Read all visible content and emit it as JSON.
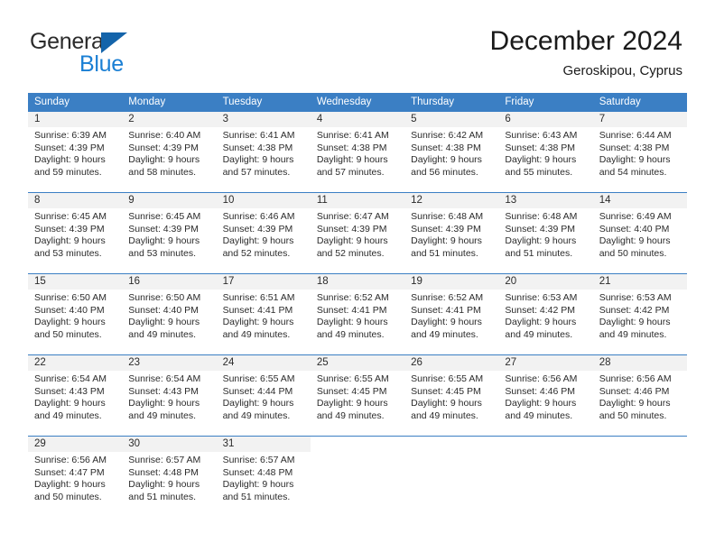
{
  "brand": {
    "word1": "General",
    "word2": "Blue",
    "triangle_color": "#1464aa",
    "blue_color": "#1a7fd4"
  },
  "header": {
    "title": "December 2024",
    "subtitle": "Geroskipou, Cyprus"
  },
  "theme": {
    "header_row_bg": "#3b7fc4",
    "day_number_bg": "#f2f2f2",
    "text_color": "#2b2b2b"
  },
  "calendar": {
    "day_headers": [
      "Sunday",
      "Monday",
      "Tuesday",
      "Wednesday",
      "Thursday",
      "Friday",
      "Saturday"
    ],
    "weeks": [
      [
        {
          "day": "1",
          "sunrise": "Sunrise: 6:39 AM",
          "sunset": "Sunset: 4:39 PM",
          "daylight1": "Daylight: 9 hours",
          "daylight2": "and 59 minutes."
        },
        {
          "day": "2",
          "sunrise": "Sunrise: 6:40 AM",
          "sunset": "Sunset: 4:39 PM",
          "daylight1": "Daylight: 9 hours",
          "daylight2": "and 58 minutes."
        },
        {
          "day": "3",
          "sunrise": "Sunrise: 6:41 AM",
          "sunset": "Sunset: 4:38 PM",
          "daylight1": "Daylight: 9 hours",
          "daylight2": "and 57 minutes."
        },
        {
          "day": "4",
          "sunrise": "Sunrise: 6:41 AM",
          "sunset": "Sunset: 4:38 PM",
          "daylight1": "Daylight: 9 hours",
          "daylight2": "and 57 minutes."
        },
        {
          "day": "5",
          "sunrise": "Sunrise: 6:42 AM",
          "sunset": "Sunset: 4:38 PM",
          "daylight1": "Daylight: 9 hours",
          "daylight2": "and 56 minutes."
        },
        {
          "day": "6",
          "sunrise": "Sunrise: 6:43 AM",
          "sunset": "Sunset: 4:38 PM",
          "daylight1": "Daylight: 9 hours",
          "daylight2": "and 55 minutes."
        },
        {
          "day": "7",
          "sunrise": "Sunrise: 6:44 AM",
          "sunset": "Sunset: 4:38 PM",
          "daylight1": "Daylight: 9 hours",
          "daylight2": "and 54 minutes."
        }
      ],
      [
        {
          "day": "8",
          "sunrise": "Sunrise: 6:45 AM",
          "sunset": "Sunset: 4:39 PM",
          "daylight1": "Daylight: 9 hours",
          "daylight2": "and 53 minutes."
        },
        {
          "day": "9",
          "sunrise": "Sunrise: 6:45 AM",
          "sunset": "Sunset: 4:39 PM",
          "daylight1": "Daylight: 9 hours",
          "daylight2": "and 53 minutes."
        },
        {
          "day": "10",
          "sunrise": "Sunrise: 6:46 AM",
          "sunset": "Sunset: 4:39 PM",
          "daylight1": "Daylight: 9 hours",
          "daylight2": "and 52 minutes."
        },
        {
          "day": "11",
          "sunrise": "Sunrise: 6:47 AM",
          "sunset": "Sunset: 4:39 PM",
          "daylight1": "Daylight: 9 hours",
          "daylight2": "and 52 minutes."
        },
        {
          "day": "12",
          "sunrise": "Sunrise: 6:48 AM",
          "sunset": "Sunset: 4:39 PM",
          "daylight1": "Daylight: 9 hours",
          "daylight2": "and 51 minutes."
        },
        {
          "day": "13",
          "sunrise": "Sunrise: 6:48 AM",
          "sunset": "Sunset: 4:39 PM",
          "daylight1": "Daylight: 9 hours",
          "daylight2": "and 51 minutes."
        },
        {
          "day": "14",
          "sunrise": "Sunrise: 6:49 AM",
          "sunset": "Sunset: 4:40 PM",
          "daylight1": "Daylight: 9 hours",
          "daylight2": "and 50 minutes."
        }
      ],
      [
        {
          "day": "15",
          "sunrise": "Sunrise: 6:50 AM",
          "sunset": "Sunset: 4:40 PM",
          "daylight1": "Daylight: 9 hours",
          "daylight2": "and 50 minutes."
        },
        {
          "day": "16",
          "sunrise": "Sunrise: 6:50 AM",
          "sunset": "Sunset: 4:40 PM",
          "daylight1": "Daylight: 9 hours",
          "daylight2": "and 49 minutes."
        },
        {
          "day": "17",
          "sunrise": "Sunrise: 6:51 AM",
          "sunset": "Sunset: 4:41 PM",
          "daylight1": "Daylight: 9 hours",
          "daylight2": "and 49 minutes."
        },
        {
          "day": "18",
          "sunrise": "Sunrise: 6:52 AM",
          "sunset": "Sunset: 4:41 PM",
          "daylight1": "Daylight: 9 hours",
          "daylight2": "and 49 minutes."
        },
        {
          "day": "19",
          "sunrise": "Sunrise: 6:52 AM",
          "sunset": "Sunset: 4:41 PM",
          "daylight1": "Daylight: 9 hours",
          "daylight2": "and 49 minutes."
        },
        {
          "day": "20",
          "sunrise": "Sunrise: 6:53 AM",
          "sunset": "Sunset: 4:42 PM",
          "daylight1": "Daylight: 9 hours",
          "daylight2": "and 49 minutes."
        },
        {
          "day": "21",
          "sunrise": "Sunrise: 6:53 AM",
          "sunset": "Sunset: 4:42 PM",
          "daylight1": "Daylight: 9 hours",
          "daylight2": "and 49 minutes."
        }
      ],
      [
        {
          "day": "22",
          "sunrise": "Sunrise: 6:54 AM",
          "sunset": "Sunset: 4:43 PM",
          "daylight1": "Daylight: 9 hours",
          "daylight2": "and 49 minutes."
        },
        {
          "day": "23",
          "sunrise": "Sunrise: 6:54 AM",
          "sunset": "Sunset: 4:43 PM",
          "daylight1": "Daylight: 9 hours",
          "daylight2": "and 49 minutes."
        },
        {
          "day": "24",
          "sunrise": "Sunrise: 6:55 AM",
          "sunset": "Sunset: 4:44 PM",
          "daylight1": "Daylight: 9 hours",
          "daylight2": "and 49 minutes."
        },
        {
          "day": "25",
          "sunrise": "Sunrise: 6:55 AM",
          "sunset": "Sunset: 4:45 PM",
          "daylight1": "Daylight: 9 hours",
          "daylight2": "and 49 minutes."
        },
        {
          "day": "26",
          "sunrise": "Sunrise: 6:55 AM",
          "sunset": "Sunset: 4:45 PM",
          "daylight1": "Daylight: 9 hours",
          "daylight2": "and 49 minutes."
        },
        {
          "day": "27",
          "sunrise": "Sunrise: 6:56 AM",
          "sunset": "Sunset: 4:46 PM",
          "daylight1": "Daylight: 9 hours",
          "daylight2": "and 49 minutes."
        },
        {
          "day": "28",
          "sunrise": "Sunrise: 6:56 AM",
          "sunset": "Sunset: 4:46 PM",
          "daylight1": "Daylight: 9 hours",
          "daylight2": "and 50 minutes."
        }
      ],
      [
        {
          "day": "29",
          "sunrise": "Sunrise: 6:56 AM",
          "sunset": "Sunset: 4:47 PM",
          "daylight1": "Daylight: 9 hours",
          "daylight2": "and 50 minutes."
        },
        {
          "day": "30",
          "sunrise": "Sunrise: 6:57 AM",
          "sunset": "Sunset: 4:48 PM",
          "daylight1": "Daylight: 9 hours",
          "daylight2": "and 51 minutes."
        },
        {
          "day": "31",
          "sunrise": "Sunrise: 6:57 AM",
          "sunset": "Sunset: 4:48 PM",
          "daylight1": "Daylight: 9 hours",
          "daylight2": "and 51 minutes."
        },
        {
          "day": "",
          "sunrise": "",
          "sunset": "",
          "daylight1": "",
          "daylight2": ""
        },
        {
          "day": "",
          "sunrise": "",
          "sunset": "",
          "daylight1": "",
          "daylight2": ""
        },
        {
          "day": "",
          "sunrise": "",
          "sunset": "",
          "daylight1": "",
          "daylight2": ""
        },
        {
          "day": "",
          "sunrise": "",
          "sunset": "",
          "daylight1": "",
          "daylight2": ""
        }
      ]
    ]
  }
}
